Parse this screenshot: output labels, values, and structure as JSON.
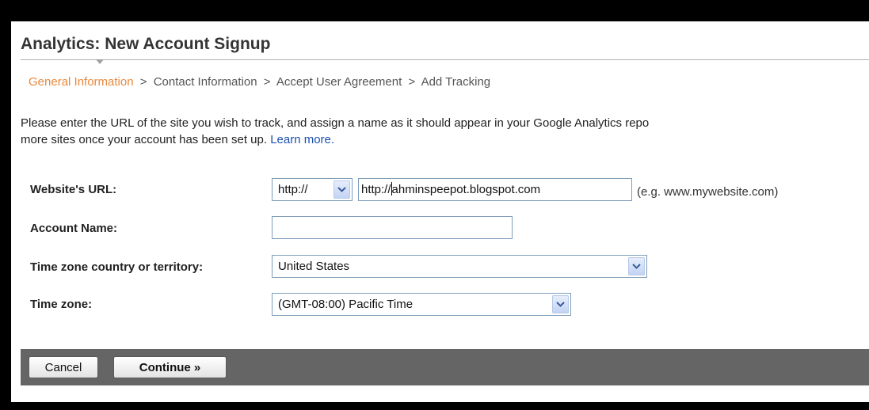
{
  "page": {
    "title": "Analytics: New Account Signup"
  },
  "steps": [
    {
      "label": "General Information",
      "active": true
    },
    {
      "label": "Contact Information"
    },
    {
      "label": "Accept User Agreement"
    },
    {
      "label": "Add Tracking"
    }
  ],
  "step_separator": ">",
  "intro": {
    "line1": "Please enter the URL of the site you wish to track, and assign a name as it should appear in your Google Analytics repo",
    "line2": "more sites once your account has been set up.",
    "learn_more": "Learn more."
  },
  "form": {
    "website_url": {
      "label": "Website's URL:",
      "protocol": "http://",
      "value_before_caret": "http://",
      "value_after_caret": "ahminspeepot.blogspot.com",
      "hint": "(e.g. www.mywebsite.com)"
    },
    "account_name": {
      "label": "Account Name:",
      "value": ""
    },
    "country": {
      "label": "Time zone country or territory:",
      "value": "United States"
    },
    "timezone": {
      "label": "Time zone:",
      "value": "(GMT-08:00) Pacific Time"
    }
  },
  "buttons": {
    "cancel": "Cancel",
    "continue": "Continue »"
  },
  "colors": {
    "active_step": "#e8883c",
    "link": "#1a4fb0",
    "footer": "#656565"
  }
}
